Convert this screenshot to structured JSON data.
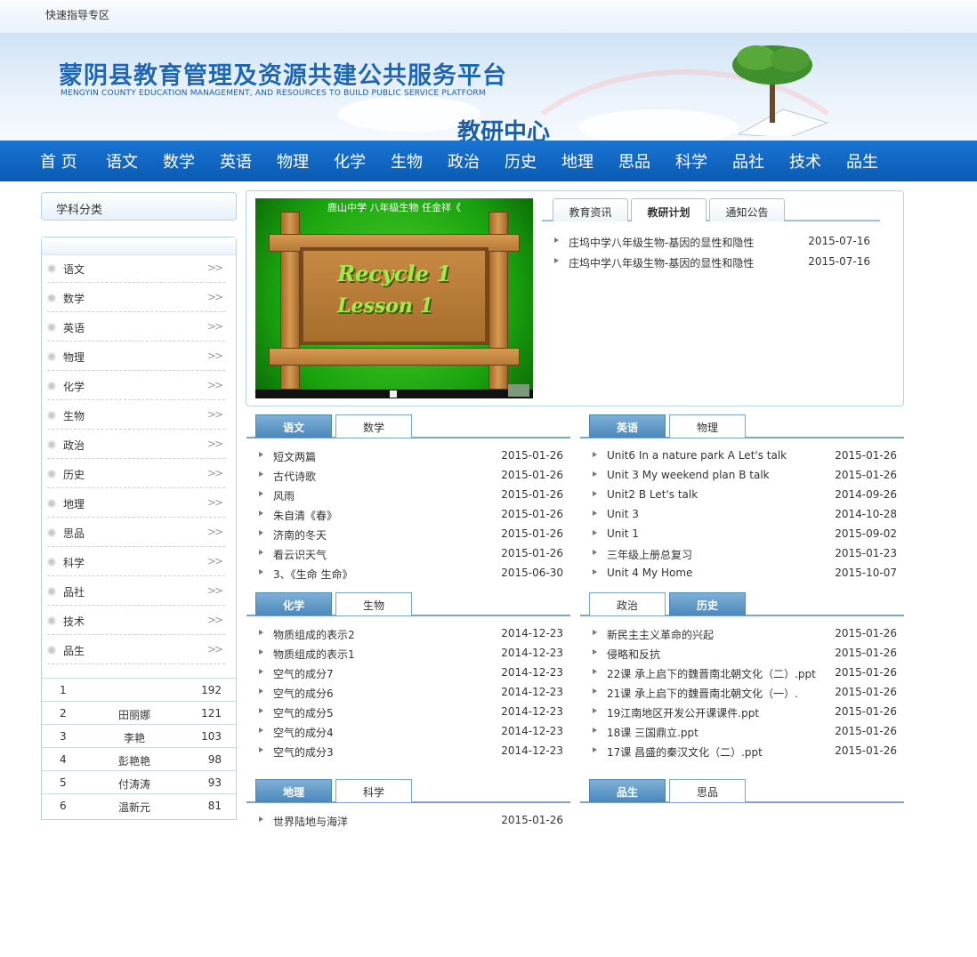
{
  "topbar": {
    "link": "快速指导专区"
  },
  "banner": {
    "title_cn": "蒙阴县教育管理及资源共建公共服务平台",
    "title_en": "MENGYIN COUNTY EDUCATION MANAGEMENT, AND RESOURCES TO BUILD PUBLIC SERVICE PLATFORM",
    "subtitle": "教研中心"
  },
  "nav": [
    "首 页",
    "语文",
    "数学",
    "英语",
    "物理",
    "化学",
    "生物",
    "政治",
    "历史",
    "地理",
    "思品",
    "科学",
    "品社",
    "技术",
    "品生"
  ],
  "sidebar": {
    "title": "学科分类",
    "subjects": [
      "语文",
      "数学",
      "英语",
      "物理",
      "化学",
      "生物",
      "政治",
      "历史",
      "地理",
      "思品",
      "科学",
      "品社",
      "技术",
      "品生"
    ],
    "arrow": ">>",
    "ranking": [
      {
        "n": "1",
        "name": "",
        "v": "192"
      },
      {
        "n": "2",
        "name": "田丽娜",
        "v": "121"
      },
      {
        "n": "3",
        "name": "李艳",
        "v": "103"
      },
      {
        "n": "4",
        "name": "彭艳艳",
        "v": "98"
      },
      {
        "n": "5",
        "name": "付涛涛",
        "v": "93"
      },
      {
        "n": "6",
        "name": "温新元",
        "v": "81"
      }
    ]
  },
  "video": {
    "caption": "鹿山中学 八年级生物 任金祥《",
    "line1": "Recycle 1",
    "line2": "Lesson 1"
  },
  "feature_tabs": [
    "教育资讯",
    "教研计划",
    "通知公告"
  ],
  "feature_news": [
    {
      "t": "庄坞中学八年级生物-基因的显性和隐性",
      "d": "2015-07-16"
    },
    {
      "t": "庄坞中学八年级生物-基因的显性和隐性",
      "d": "2015-07-16"
    }
  ],
  "panels": [
    {
      "tabs": [
        "语文",
        "数学"
      ],
      "active": 0,
      "items": [
        {
          "t": "短文两篇",
          "d": "2015-01-26"
        },
        {
          "t": "古代诗歌",
          "d": "2015-01-26"
        },
        {
          "t": "风雨",
          "d": "2015-01-26"
        },
        {
          "t": "朱自清《春》",
          "d": "2015-01-26"
        },
        {
          "t": "济南的冬天",
          "d": "2015-01-26"
        },
        {
          "t": "看云识天气",
          "d": "2015-01-26"
        },
        {
          "t": "3、《生命 生命》",
          "d": "2015-06-30"
        }
      ]
    },
    {
      "tabs": [
        "英语",
        "物理"
      ],
      "active": 0,
      "items": [
        {
          "t": "Unit6 In a nature park A Let's talk",
          "d": "2015-01-26"
        },
        {
          "t": "Unit 3 My weekend plan B talk",
          "d": "2015-01-26"
        },
        {
          "t": "Unit2 B Let's talk",
          "d": "2014-09-26"
        },
        {
          "t": "Unit 3",
          "d": "2014-10-28"
        },
        {
          "t": "Unit 1",
          "d": "2015-09-02"
        },
        {
          "t": "三年级上册总复习",
          "d": "2015-01-23"
        },
        {
          "t": "Unit 4 My Home",
          "d": "2015-10-07"
        }
      ]
    },
    {
      "tabs": [
        "化学",
        "生物"
      ],
      "active": 0,
      "items": [
        {
          "t": "物质组成的表示2",
          "d": "2014-12-23"
        },
        {
          "t": "物质组成的表示1",
          "d": "2014-12-23"
        },
        {
          "t": "空气的成分7",
          "d": "2014-12-23"
        },
        {
          "t": "空气的成分6",
          "d": "2014-12-23"
        },
        {
          "t": "空气的成分5",
          "d": "2014-12-23"
        },
        {
          "t": "空气的成分4",
          "d": "2014-12-23"
        },
        {
          "t": "空气的成分3",
          "d": "2014-12-23"
        }
      ]
    },
    {
      "tabs": [
        "政治",
        "历史"
      ],
      "active": 1,
      "items": [
        {
          "t": "新民主主义革命的兴起",
          "d": "2015-01-26"
        },
        {
          "t": "侵略和反抗",
          "d": "2015-01-26"
        },
        {
          "t": "22课 承上启下的魏晋南北朝文化（二）.ppt",
          "d": "2015-01-26"
        },
        {
          "t": "21课 承上启下的魏晋南北朝文化（一）.",
          "d": "2015-01-26"
        },
        {
          "t": "19江南地区开发公开课课件.ppt",
          "d": "2015-01-26"
        },
        {
          "t": "18课 三国鼎立.ppt",
          "d": "2015-01-26"
        },
        {
          "t": "17课 昌盛的秦汉文化（二）.ppt",
          "d": "2015-01-26"
        }
      ]
    },
    {
      "tabs": [
        "地理",
        "科学"
      ],
      "active": 0,
      "items": [
        {
          "t": "世界陆地与海洋",
          "d": "2015-01-26"
        }
      ]
    },
    {
      "tabs": [
        "品生",
        "思品"
      ],
      "active": 0,
      "items": []
    }
  ]
}
